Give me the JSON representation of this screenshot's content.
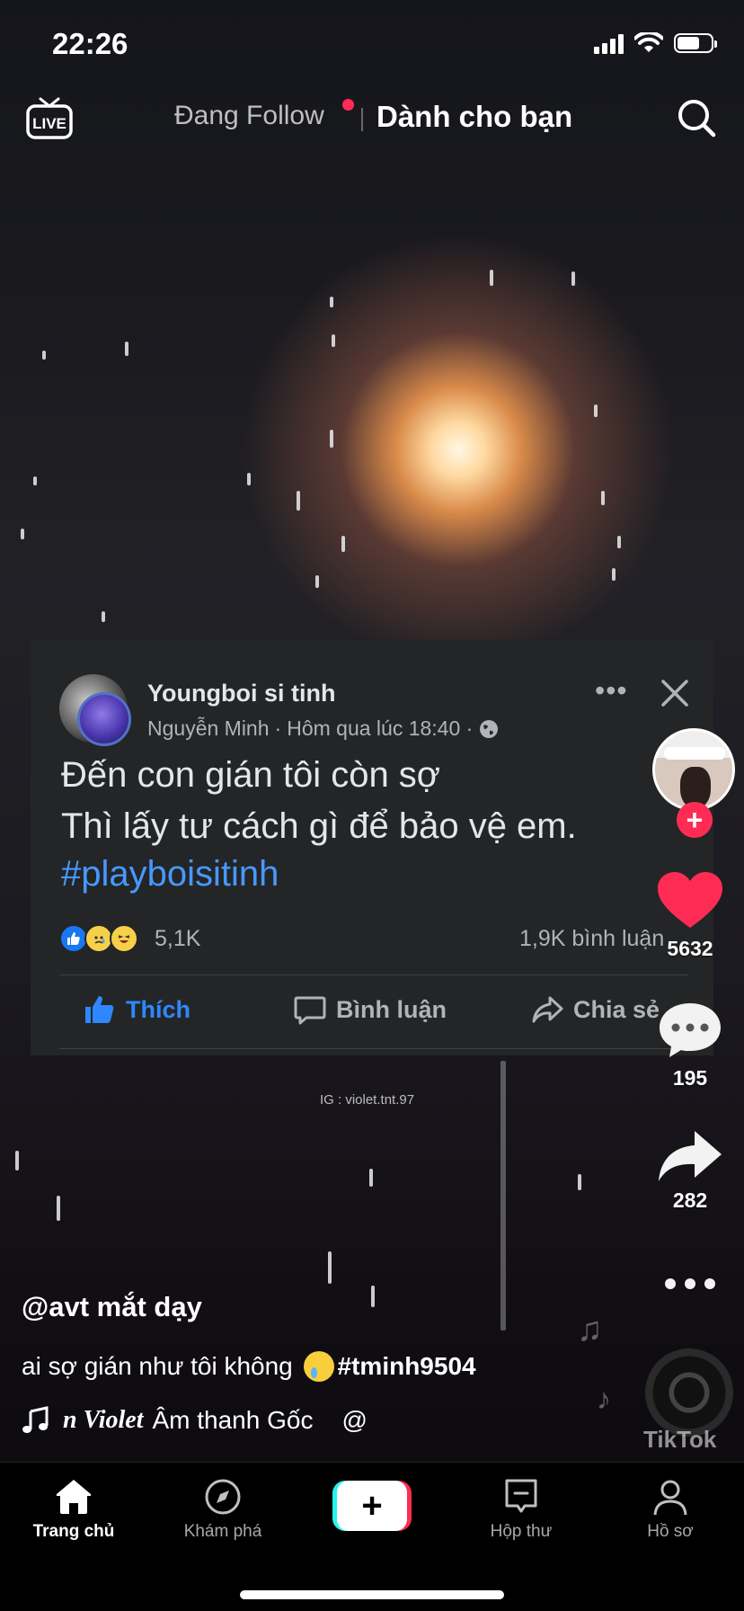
{
  "status_bar": {
    "time": "22:26"
  },
  "top_nav": {
    "live_label": "LIVE",
    "tab_following": "Đang Follow",
    "tab_for_you": "Dành cho bạn"
  },
  "fb_post": {
    "page_name": "Youngboi si tinh",
    "author": "Nguyễn Minh",
    "time": "Hôm qua lúc 18:40 ·",
    "text_line1": "Đến con gián tôi còn sợ",
    "text_line2": "Thì lấy tư cách gì để bảo vệ em.",
    "hashtag": "#playboisitinh",
    "reaction_count": "5,1K",
    "comment_count": "1,9K bình luận",
    "actions": {
      "like": "Thích",
      "comment": "Bình luận",
      "share": "Chia sẻ"
    },
    "more_glyph": "•••"
  },
  "video_watermark": "IG : violet.tnt.97",
  "right_rail": {
    "likes": "5632",
    "comments": "195",
    "shares": "282"
  },
  "tiktok_watermark": "TikTok",
  "caption": {
    "username": "@avt mắt dạy",
    "text": "ai sợ gián như tôi không",
    "hashtag": "#tminh9504",
    "music_name": "n Violet",
    "music_suffix": "Âm thanh Gốc",
    "music_trail": "@"
  },
  "tab_bar": {
    "home": "Trang chủ",
    "discover": "Khám phá",
    "create": "+",
    "inbox": "Hộp thư",
    "profile": "Hồ sơ"
  },
  "colors": {
    "accent_red": "#fe2c55",
    "accent_cyan": "#25f4ee",
    "fb_blue": "#2d88ff",
    "fb_card": "#242526"
  }
}
